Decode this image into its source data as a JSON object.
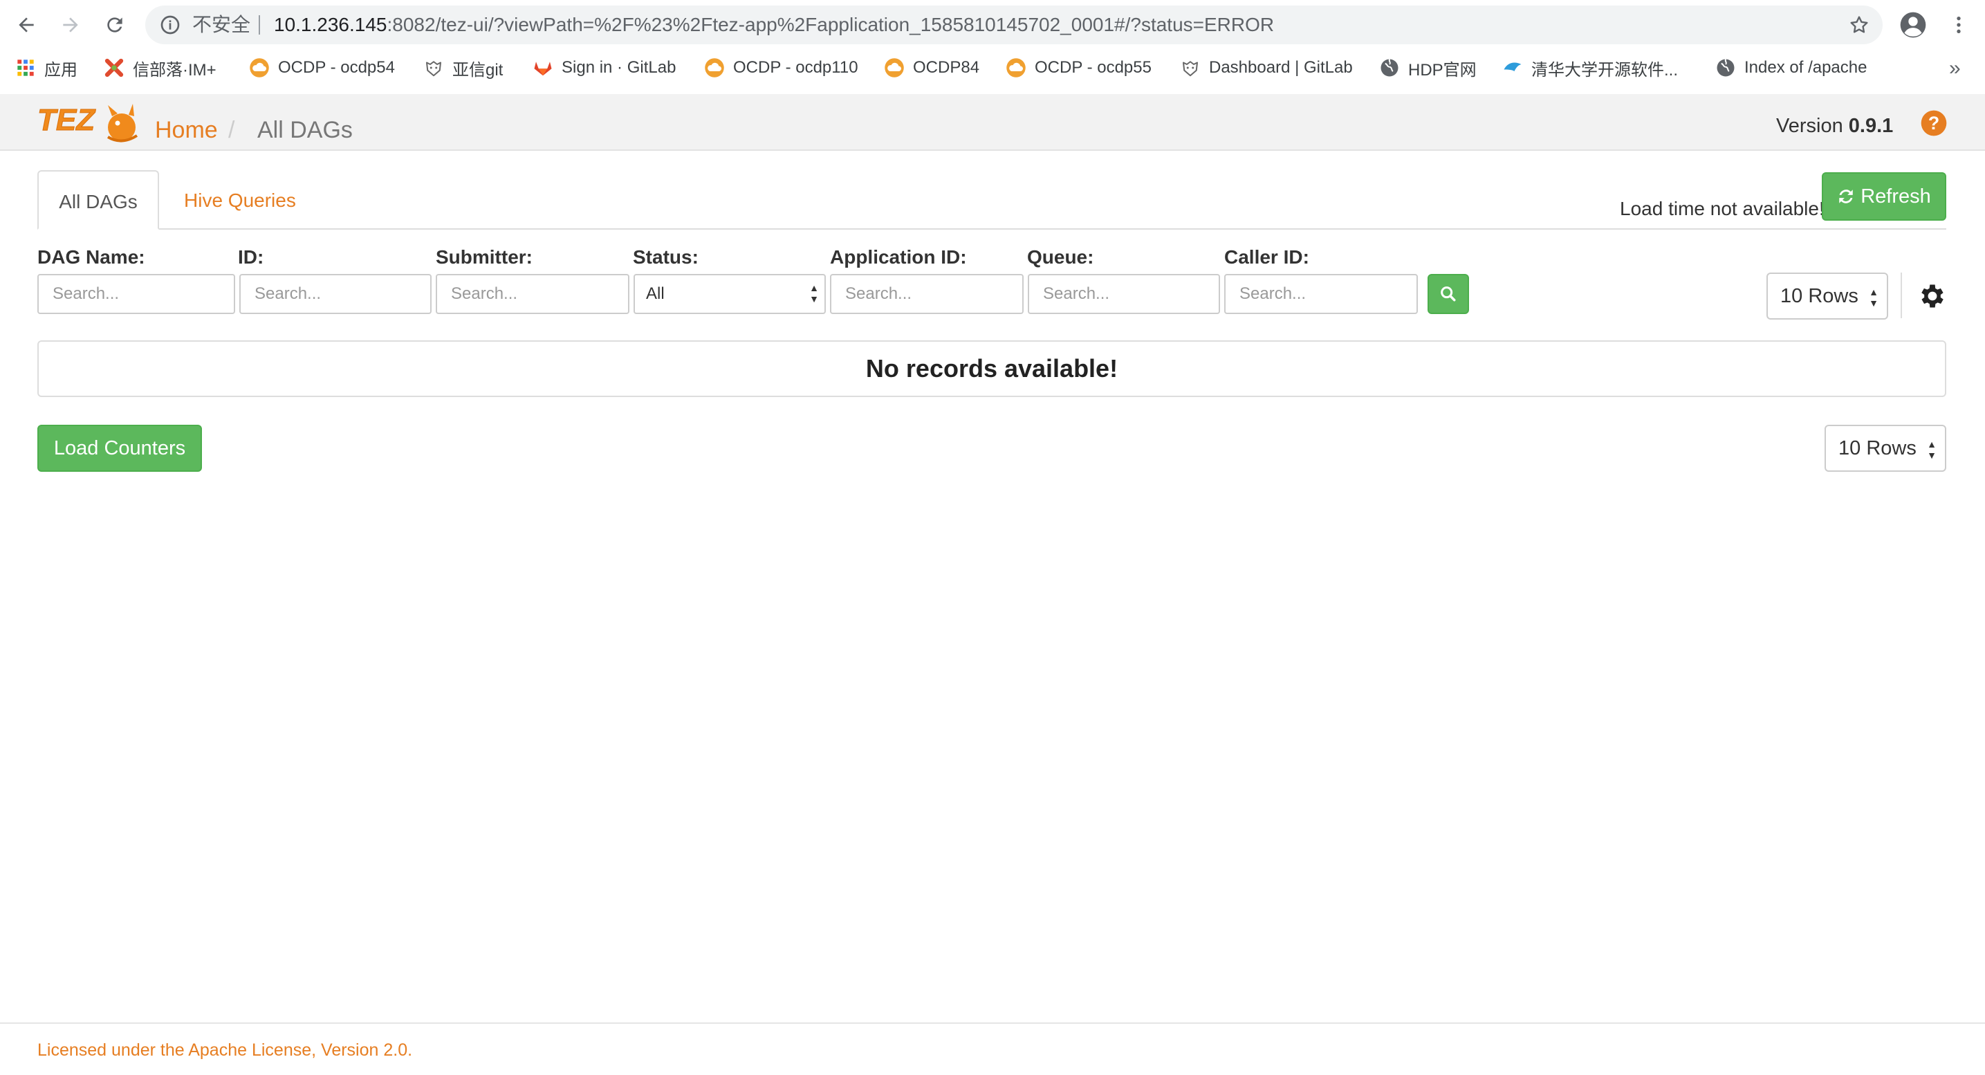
{
  "browser": {
    "security_label": "不安全",
    "url_host": "10.1.236.145",
    "url_rest": ":8082/tez-ui/?viewPath=%2F%23%2Ftez-app%2Fapplication_1585810145702_0001#/?status=ERROR",
    "bookmarks": [
      {
        "label": "应用",
        "icon": "apps-grid-icon"
      },
      {
        "label": "信部落·IM+",
        "icon": "im-plus-icon"
      },
      {
        "label": "OCDP - ocdp54",
        "icon": "cloud-icon"
      },
      {
        "label": "亚信git",
        "icon": "gitea-icon"
      },
      {
        "label": "Sign in · GitLab",
        "icon": "gitlab-icon"
      },
      {
        "label": "OCDP - ocdp110",
        "icon": "cloud-icon"
      },
      {
        "label": "OCDP84",
        "icon": "cloud-icon"
      },
      {
        "label": "OCDP - ocdp55",
        "icon": "cloud-icon"
      },
      {
        "label": "Dashboard | GitLab",
        "icon": "gitea-icon"
      },
      {
        "label": "HDP官网",
        "icon": "globe-icon"
      },
      {
        "label": "清华大学开源软件...",
        "icon": "tuna-icon"
      },
      {
        "label": "Index of /apache",
        "icon": "globe-icon"
      }
    ],
    "more_label": "»"
  },
  "header": {
    "crumb_home": "Home",
    "crumb_sep": "/",
    "crumb_current": "All DAGs",
    "version_label": "Version",
    "version_number": "0.9.1"
  },
  "tabs": {
    "all_dags": "All DAGs",
    "hive_queries": "Hive Queries"
  },
  "load_time": "Load time not available!",
  "refresh_label": "Refresh",
  "filters": {
    "dag_name": {
      "label": "DAG Name:",
      "placeholder": "Search..."
    },
    "id": {
      "label": "ID:",
      "placeholder": "Search..."
    },
    "submitter": {
      "label": "Submitter:",
      "placeholder": "Search..."
    },
    "status": {
      "label": "Status:",
      "value": "All"
    },
    "application_id": {
      "label": "Application ID:",
      "placeholder": "Search..."
    },
    "queue": {
      "label": "Queue:",
      "placeholder": "Search..."
    },
    "caller_id": {
      "label": "Caller ID:",
      "placeholder": "Search..."
    }
  },
  "rows_top": "10 Rows",
  "rows_bottom": "10 Rows",
  "empty_message": "No records available!",
  "load_counters_label": "Load Counters",
  "footer": "Licensed under the Apache License, Version 2.0.",
  "colors": {
    "accent": "#e67e22",
    "success": "#5cb85c"
  }
}
